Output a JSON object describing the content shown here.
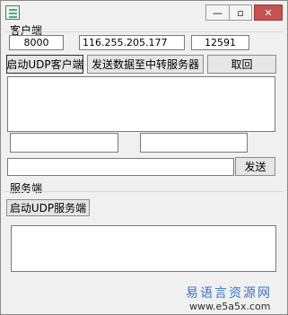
{
  "window": {
    "minimize_glyph": "—",
    "maximize_glyph": "▫",
    "close_glyph": "✕",
    "icon": "app-icon"
  },
  "client": {
    "section_label": "客户端",
    "local_port": "8000",
    "server_ip": "116.255.205.177",
    "remote_port": "12591",
    "start_button": "启动UDP客户端",
    "send_relay_button": "发送数据至中转服务器",
    "cancel_button": "取回",
    "send_button": "发送"
  },
  "server": {
    "section_label": "服务端",
    "start_button": "启动UDP服务端"
  },
  "watermark": {
    "text": "易语言资源网",
    "url": "www.e5a5x.com"
  }
}
